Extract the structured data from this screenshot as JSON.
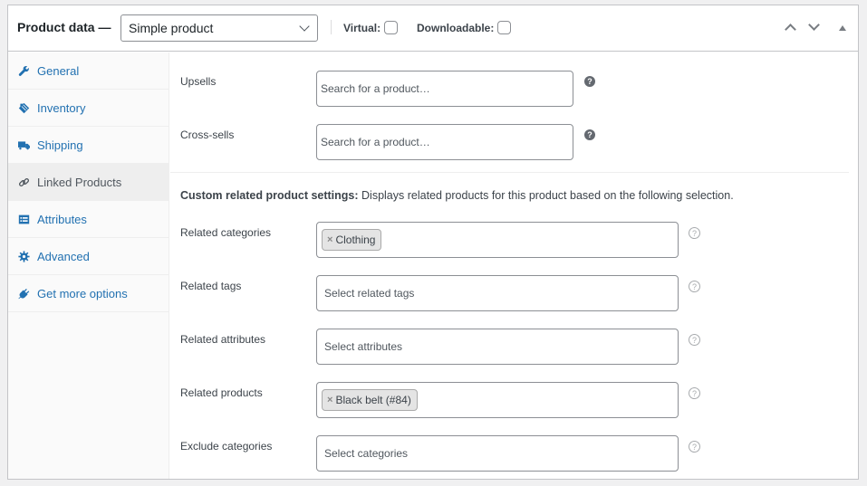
{
  "header": {
    "title": "Product data —",
    "product_type": "Simple product",
    "virtual_label": "Virtual:",
    "virtual_checked": false,
    "downloadable_label": "Downloadable:",
    "downloadable_checked": false
  },
  "sidebar": {
    "items": [
      {
        "label": "General",
        "icon": "wrench-icon",
        "active": false
      },
      {
        "label": "Inventory",
        "icon": "tag-icon",
        "active": false
      },
      {
        "label": "Shipping",
        "icon": "truck-icon",
        "active": false
      },
      {
        "label": "Linked Products",
        "icon": "link-icon",
        "active": true
      },
      {
        "label": "Attributes",
        "icon": "list-card-icon",
        "active": false
      },
      {
        "label": "Advanced",
        "icon": "gear-icon",
        "active": false
      },
      {
        "label": "Get more options",
        "icon": "plugin-icon",
        "active": false
      }
    ]
  },
  "linked": {
    "upsells": {
      "label": "Upsells",
      "placeholder": "Search for a product…"
    },
    "crosssells": {
      "label": "Cross-sells",
      "placeholder": "Search for a product…"
    }
  },
  "custom": {
    "heading": "Custom related product settings:",
    "description": " Displays related products for this product based on the following selection.",
    "fields": {
      "related_categories": {
        "label": "Related categories",
        "chips": [
          "Clothing"
        ],
        "placeholder": ""
      },
      "related_tags": {
        "label": "Related tags",
        "placeholder": "Select related tags"
      },
      "related_attributes": {
        "label": "Related attributes",
        "placeholder": "Select attributes"
      },
      "related_products": {
        "label": "Related products",
        "chips": [
          "Black belt (#84)"
        ],
        "placeholder": ""
      },
      "exclude_categories": {
        "label": "Exclude categories",
        "placeholder": "Select categories"
      }
    }
  },
  "chip_remove_glyph": "×",
  "help_glyph": "?"
}
